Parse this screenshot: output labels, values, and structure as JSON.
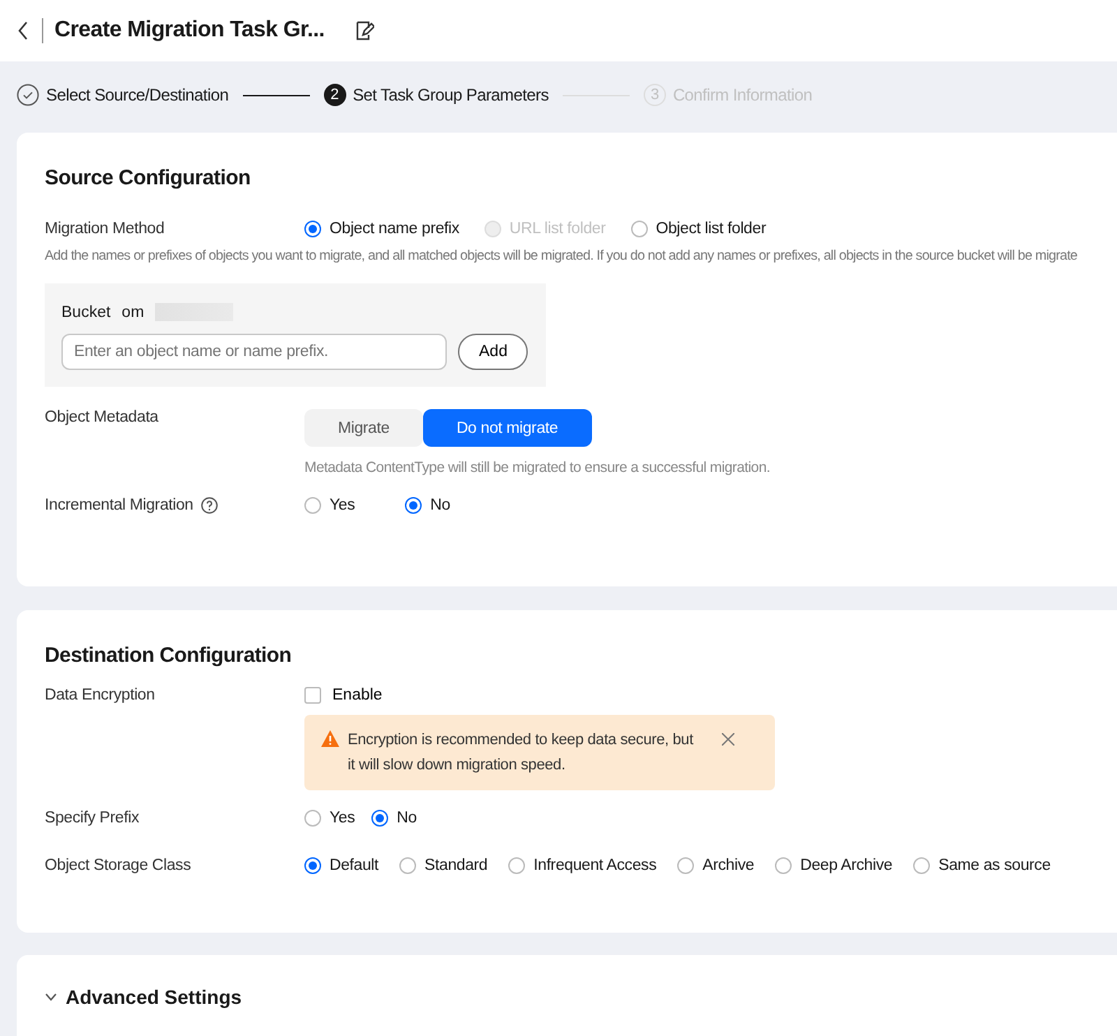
{
  "header": {
    "title": "Create Migration Task Gr..."
  },
  "steps": [
    {
      "label": "Select Source/Destination",
      "completed": true,
      "selected": false
    },
    {
      "number": "2",
      "label": "Set Task Group Parameters",
      "completed": false,
      "selected": true
    },
    {
      "number": "3",
      "label": "Confirm Information",
      "completed": false,
      "selected": false
    }
  ],
  "source": {
    "title": "Source Configuration",
    "migration_method": {
      "label": "Migration Method",
      "options": [
        {
          "label": "Object name prefix",
          "selected": true,
          "disabled": false
        },
        {
          "label": "URL list folder",
          "selected": false,
          "disabled": true
        },
        {
          "label": "Object list folder",
          "selected": false,
          "disabled": false
        }
      ]
    },
    "description": "Add the names or prefixes of objects you want to migrate, and all matched objects will be migrated. If you do not add any names or prefixes, all objects in the source bucket will be migrate",
    "bucket": {
      "label": "Bucket",
      "value": "om",
      "placeholder": "Enter an object name or name prefix.",
      "add_button": "Add"
    },
    "metadata": {
      "label": "Object Metadata",
      "options": [
        {
          "label": "Migrate",
          "selected": false
        },
        {
          "label": "Do not migrate",
          "selected": true
        }
      ],
      "hint": "Metadata ContentType will still be migrated to ensure a successful migration."
    },
    "incremental": {
      "label": "Incremental Migration",
      "options": [
        {
          "label": "Yes",
          "selected": false
        },
        {
          "label": "No",
          "selected": true
        }
      ]
    }
  },
  "destination": {
    "title": "Destination Configuration",
    "encryption": {
      "label": "Data Encryption",
      "checkbox": "Enable",
      "checked": false,
      "warning": "Encryption is recommended to keep data secure, but it will slow down migration speed."
    },
    "prefix": {
      "label": "Specify Prefix",
      "options": [
        {
          "label": "Yes",
          "selected": false
        },
        {
          "label": "No",
          "selected": true
        }
      ]
    },
    "storage_class": {
      "label": "Object Storage Class",
      "options": [
        {
          "label": "Default",
          "selected": true
        },
        {
          "label": "Standard",
          "selected": false
        },
        {
          "label": "Infrequent Access",
          "selected": false
        },
        {
          "label": "Archive",
          "selected": false
        },
        {
          "label": "Deep Archive",
          "selected": false
        },
        {
          "label": "Same as source",
          "selected": false
        }
      ]
    }
  },
  "advanced": {
    "title": "Advanced Settings",
    "expanded": false
  }
}
